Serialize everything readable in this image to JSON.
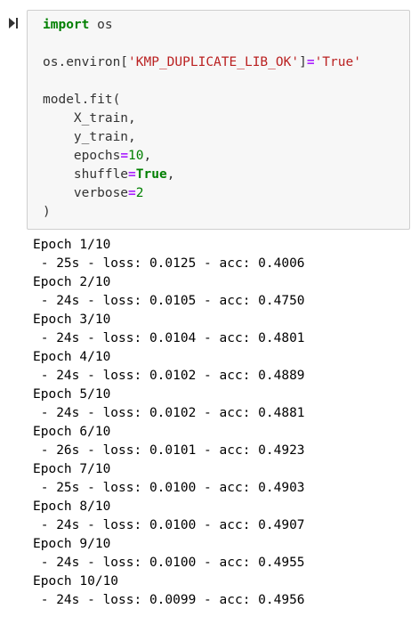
{
  "cell": {
    "code": {
      "import_kw": "import",
      "import_module": " os",
      "environ_prefix": "os.environ[",
      "environ_key": "'KMP_DUPLICATE_LIB_OK'",
      "environ_close": "]",
      "environ_eq": "=",
      "environ_value": "'True'",
      "fit_call": "model.fit(",
      "arg_x": "    X_train,",
      "arg_y": "    y_train,",
      "arg_epochs_name": "    epochs",
      "arg_epochs_eq": "=",
      "arg_epochs_value": "10",
      "arg_epochs_comma": ",",
      "arg_shuffle_name": "    shuffle",
      "arg_shuffle_eq": "=",
      "arg_shuffle_value": "True",
      "arg_shuffle_comma": ",",
      "arg_verbose_name": "    verbose",
      "arg_verbose_eq": "=",
      "arg_verbose_value": "2",
      "close_paren": ")"
    }
  },
  "output": {
    "lines": [
      "Epoch 1/10",
      " - 25s - loss: 0.0125 - acc: 0.4006",
      "Epoch 2/10",
      " - 24s - loss: 0.0105 - acc: 0.4750",
      "Epoch 3/10",
      " - 24s - loss: 0.0104 - acc: 0.4801",
      "Epoch 4/10",
      " - 24s - loss: 0.0102 - acc: 0.4889",
      "Epoch 5/10",
      " - 24s - loss: 0.0102 - acc: 0.4881",
      "Epoch 6/10",
      " - 26s - loss: 0.0101 - acc: 0.4923",
      "Epoch 7/10",
      " - 25s - loss: 0.0100 - acc: 0.4903",
      "Epoch 8/10",
      " - 24s - loss: 0.0100 - acc: 0.4907",
      "Epoch 9/10",
      " - 24s - loss: 0.0100 - acc: 0.4955",
      "Epoch 10/10",
      " - 24s - loss: 0.0099 - acc: 0.4956"
    ]
  },
  "icons": {
    "run": "run-cell-icon"
  },
  "colors": {
    "keyword": "#008000",
    "string": "#ba2121",
    "operator": "#aa22ff",
    "number": "#008000",
    "cell_background": "#f7f7f7",
    "cell_border": "#cfcfcf"
  }
}
